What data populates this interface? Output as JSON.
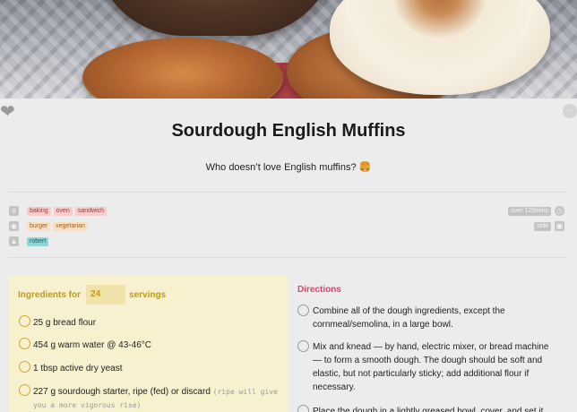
{
  "recipe": {
    "title": "Sourdough English Muffins",
    "subtitle": "Who doesn’t love English muffins? 🍔"
  },
  "meta": {
    "category_tags": [
      "baking",
      "oven",
      "sandwich"
    ],
    "course_tags": [
      "burger",
      "vegetarian"
    ],
    "author_tags": [
      "robert"
    ],
    "time_label": "over 120mins",
    "course_label": "side"
  },
  "ingredients": {
    "label_prefix": "Ingredients for",
    "servings": "24",
    "label_suffix": "servings",
    "items": [
      {
        "text": "25 g bread flour",
        "note": ""
      },
      {
        "text": "454 g warm water @ 43-46°C",
        "note": ""
      },
      {
        "text": "1 tbsp active dry yeast",
        "note": ""
      },
      {
        "text": "227 g sourdough starter, ripe (fed) or discard",
        "note": "(ripe will give you a more vigorous rise)"
      }
    ]
  },
  "directions": {
    "title": "Directions",
    "items": [
      "Combine all of the dough ingredients, except the cornmeal/semolina, in a large bowl.",
      "Mix and knead — by hand, electric mixer, or bread machine — to form a smooth dough. The dough should be soft and elastic, but not particularly sticky; add additional flour if necessary.",
      "Place the dough in a lightly greased bowl, cover, and set it"
    ]
  },
  "icons": {
    "favorite": "heart-icon",
    "more": "more-options-icon",
    "tags": "hashtag-icon",
    "course": "cutlery-icon",
    "author": "chef-hat-icon",
    "time": "clock-icon",
    "course_type": "plate-icon"
  },
  "colors": {
    "ingredients_accent": "#c49a10",
    "directions_accent": "#e0436a",
    "ingredients_bg": "#f7f1cf"
  }
}
